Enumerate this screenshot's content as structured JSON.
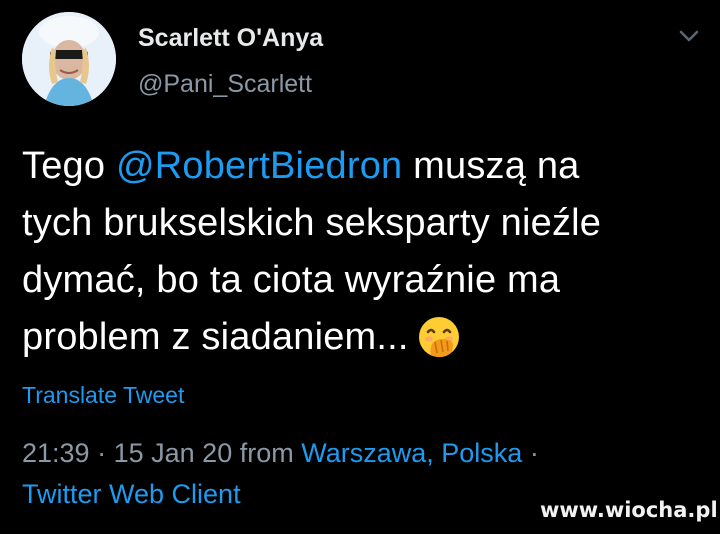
{
  "tweet": {
    "author_name": "Scarlett O'Anya",
    "author_handle": "@Pani_Scarlett",
    "text_lines": [
      {
        "pre": "Tego ",
        "mention": "@RobertBiedron",
        "post": " muszą na"
      },
      "tych brukselskich seksparty nieźle",
      "dymać, bo ta ciota wyraźnie ma",
      "problem z siadaniem..."
    ],
    "emoji": "face-with-hand-over-mouth-emoji",
    "translate_label": "Translate Tweet",
    "time": "21:39",
    "separator": "·",
    "date": "15 Jan 20",
    "from_label": "from",
    "location": "Warszawa, Polska",
    "client": "Twitter Web Client"
  },
  "icons": {
    "menu": "chevron-down-icon"
  },
  "colors": {
    "background": "#000000",
    "text": "#ffffff",
    "link": "#1d9bf0",
    "secondary": "#8b98a5"
  },
  "watermark": "www.wiocha.pl"
}
